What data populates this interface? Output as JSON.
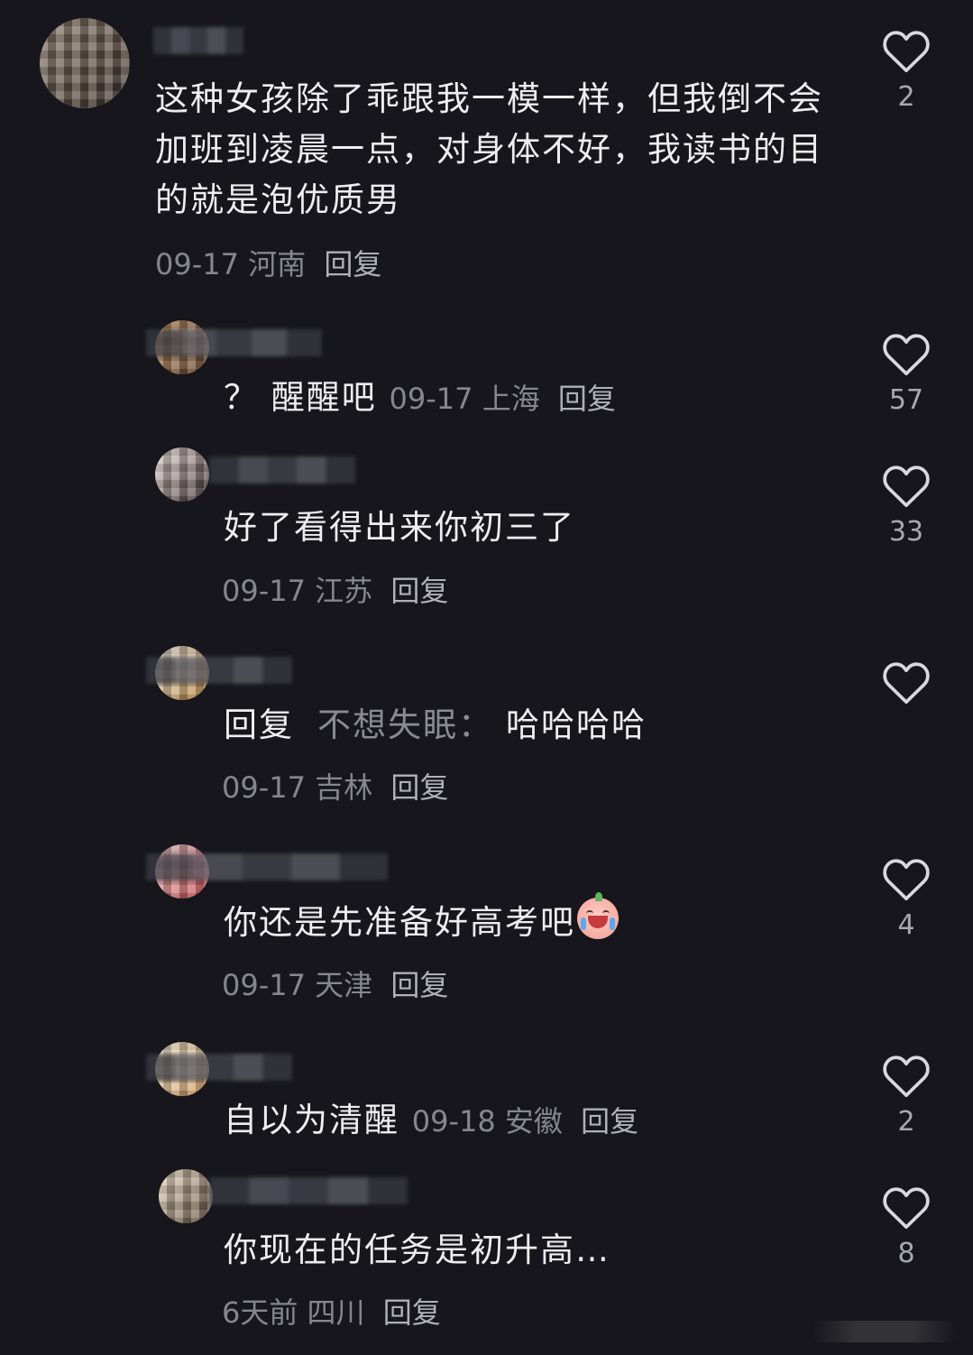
{
  "comments": [
    {
      "text": "这种女孩除了乖跟我一模一样，但我倒不会加班到凌晨一点，对身体不好，我读书的目的就是泡优质男",
      "date": "09-17",
      "location": "河南",
      "reply": "回复",
      "likes": "2"
    },
    {
      "text": "？ 醒醒吧",
      "date": "09-17",
      "location": "上海",
      "reply": "回复",
      "likes": "57"
    },
    {
      "text": "好了看得出来你初三了",
      "date": "09-17",
      "location": "江苏",
      "reply": "回复",
      "likes": "33"
    },
    {
      "reply_prefix": "回复",
      "quoted_user": "不想失眠：",
      "text": "哈哈哈哈",
      "date": "09-17",
      "location": "吉林",
      "reply": "回复",
      "likes": ""
    },
    {
      "text": "你还是先准备好高考吧",
      "date": "09-17",
      "location": "天津",
      "reply": "回复",
      "likes": "4",
      "emoji": "crying-laughing-emoji"
    },
    {
      "text": "自以为清醒",
      "date": "09-18",
      "location": "安徽",
      "reply": "回复",
      "likes": "2"
    },
    {
      "text": "你现在的任务是初升高…",
      "date": "6天前",
      "location": "四川",
      "reply": "回复",
      "likes": "8"
    }
  ],
  "icons": {
    "like": "heart-outline-icon"
  },
  "colors": {
    "background": "#16161c",
    "text": "#eeeef0",
    "meta": "#86868e"
  }
}
